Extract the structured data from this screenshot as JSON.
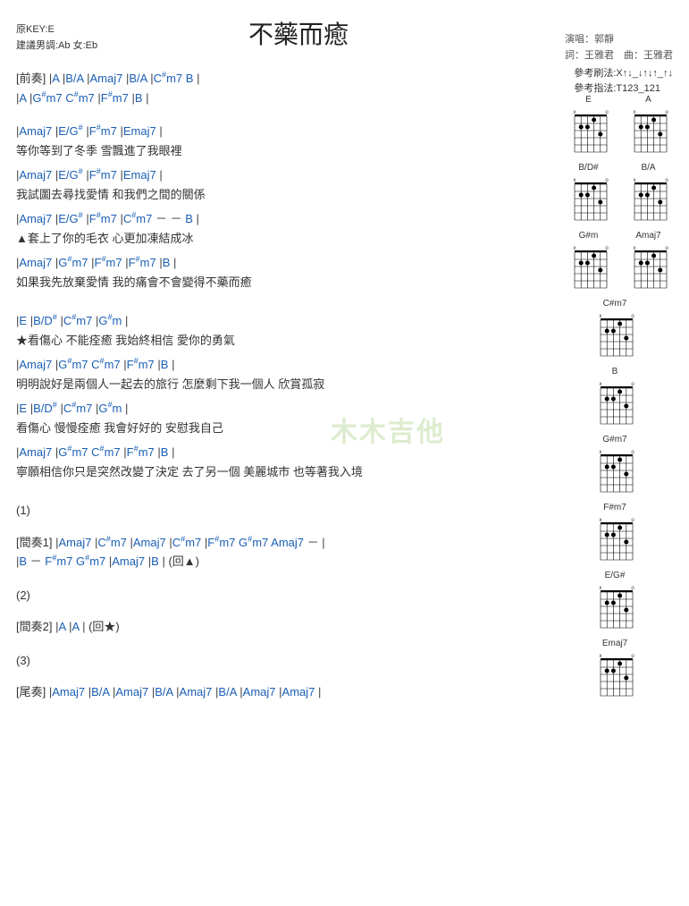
{
  "title": "不藥而癒",
  "meta": {
    "original_key": "原KEY:E",
    "suggested_key": "建議男調:Ab 女:Eb",
    "singer": "演唱：郭靜",
    "credits": "詞：王雅君　曲：王雅君"
  },
  "reference": {
    "strum": "參考刷法:X↑↓_↓↑↓↑_↑↓",
    "fingering": "參考指法:T123_121"
  },
  "watermark": "木木吉他",
  "chord_diagrams": [
    [
      {
        "name": "E"
      },
      {
        "name": "A"
      }
    ],
    [
      {
        "name": "B/D#"
      },
      {
        "name": "B/A"
      }
    ],
    [
      {
        "name": "G#m"
      },
      {
        "name": "Amaj7"
      }
    ],
    [
      {
        "name": "C#m7"
      }
    ],
    [
      {
        "name": "B"
      }
    ],
    [
      {
        "name": "G#m7"
      }
    ],
    [
      {
        "name": "F#m7"
      }
    ],
    [
      {
        "name": "E/G#"
      }
    ],
    [
      {
        "name": "Emaj7"
      }
    ]
  ],
  "lines": [
    {
      "type": "chords",
      "html": "<span class='section-label'>[前奏]</span> <span class='bar'>|</span><span class='chord'>A</span>    <span class='bar'>|</span><span class='chord'>B/A</span>    <span class='bar'>|</span><span class='chord'>Amaj7</span>    <span class='bar'>|</span><span class='chord'>B/A</span>    <span class='bar'>|</span><span class='chord'>C<sup>#</sup>m7</span>    <span class='chord'>B</span>    <span class='bar'>|</span>"
    },
    {
      "type": "chords",
      "html": "            <span class='bar'>|</span><span class='chord'>A</span>    <span class='bar'>|</span><span class='chord'>G<sup>#</sup>m7</span>    <span class='chord'>C<sup>#</sup>m7</span>    <span class='bar'>|</span><span class='chord'>F<sup>#</sup>m7</span>    <span class='bar'>|</span><span class='chord'>B</span>    <span class='bar'>|</span>"
    },
    {
      "type": "gap"
    },
    {
      "type": "chords",
      "html": "<span class='bar'>|</span><span class='chord'>Amaj7</span>            <span class='bar'>|</span><span class='chord'>E/G<sup>#</sup></span>      <span class='bar'>|</span><span class='chord'>F<sup>#</sup>m7</span>       <span class='bar'>|</span><span class='chord'>Emaj7</span>    <span class='bar'>|</span>"
    },
    {
      "type": "lyric",
      "text": "  等你等到了冬季       雪飄進了我眼裡"
    },
    {
      "type": "chords",
      "html": "<span class='bar'>|</span><span class='chord'>Amaj7</span>            <span class='bar'>|</span><span class='chord'>E/G<sup>#</sup></span>      <span class='bar'>|</span><span class='chord'>F<sup>#</sup>m7</span>       <span class='bar'>|</span><span class='chord'>Emaj7</span>    <span class='bar'>|</span>"
    },
    {
      "type": "lyric",
      "text": "  我試圖去尋找愛情   和我們之間的關係"
    },
    {
      "type": "chords",
      "html": "<span class='bar'>|</span><span class='chord'>Amaj7</span>            <span class='bar'>|</span><span class='chord'>E/G<sup>#</sup></span>     <span class='bar'>|</span><span class='chord'>F<sup>#</sup>m7</span>    <span class='bar'>|</span><span class='chord'>C<sup>#</sup>m7</span> － － <span class='chord'>B</span>    <span class='bar'>|</span>"
    },
    {
      "type": "lyric",
      "text": "▲套上了你的毛衣     心更加凍結成冰"
    },
    {
      "type": "chords",
      "html": "<span class='bar'>|</span><span class='chord'>Amaj7</span>        <span class='bar'>|</span><span class='chord'>G<sup>#</sup>m7</span>    <span class='bar'>|</span><span class='chord'>F<sup>#</sup>m7</span>           <span class='bar'>|</span><span class='chord'>F<sup>#</sup>m7</span>               <span class='bar'>|</span><span class='chord'>B</span>    <span class='bar'>|</span>"
    },
    {
      "type": "lyric",
      "text": "  如果我先放棄愛情          我的痛會不會變得不藥而癒"
    },
    {
      "type": "gap"
    },
    {
      "type": "chords",
      "html": "  <span class='bar'>|</span><span class='chord'>E</span>             <span class='bar'>|</span><span class='chord'>B/D<sup>#</sup></span>          <span class='bar'>|</span><span class='chord'>C<sup>#</sup>m7</span>          <span class='bar'>|</span><span class='chord'>G<sup>#</sup>m</span>    <span class='bar'>|</span>"
    },
    {
      "type": "lyric",
      "text": "★看傷心    不能痊癒    我始終相信    愛你的勇氣"
    },
    {
      "type": "chords",
      "html": "           <span class='bar'>|</span><span class='chord'>Amaj7</span>                <span class='bar'>|</span><span class='chord'>G<sup>#</sup>m7</span>    <span class='chord'>C<sup>#</sup>m7</span>  <span class='bar'>|</span><span class='chord'>F<sup>#</sup>m7</span>             <span class='bar'>|</span><span class='chord'>B</span>    <span class='bar'>|</span>"
    },
    {
      "type": "lyric",
      "text": "     明明說好是兩個人一起去的旅行    怎麼剩下我一個人   欣賞孤寂"
    },
    {
      "type": "chords",
      "html": "  <span class='bar'>|</span><span class='chord'>E</span>             <span class='bar'>|</span><span class='chord'>B/D<sup>#</sup></span>          <span class='bar'>|</span><span class='chord'>C<sup>#</sup>m7</span>          <span class='bar'>|</span><span class='chord'>G<sup>#</sup>m</span>    <span class='bar'>|</span>"
    },
    {
      "type": "lyric",
      "text": "  看傷心    慢慢痊癒    我會好好的    安慰我自己"
    },
    {
      "type": "chords",
      "html": "           <span class='bar'>|</span><span class='chord'>Amaj7</span>               <span class='bar'>|</span><span class='chord'>G<sup>#</sup>m7</span>    <span class='chord'>C<sup>#</sup>m7</span>  <span class='bar'>|</span><span class='chord'>F<sup>#</sup>m7</span>               <span class='bar'>|</span><span class='chord'>B</span>          <span class='bar'>|</span>"
    },
    {
      "type": "lyric",
      "text": "     寧願相信你只是突然改變了決定      去了另一個 美麗城市   也等著我入境"
    },
    {
      "type": "gap"
    },
    {
      "type": "lyric",
      "text": "(1)"
    },
    {
      "type": "small-gap"
    },
    {
      "type": "chords",
      "html": "<span class='section-label'>[間奏1]</span> <span class='bar'>|</span><span class='chord'>Amaj7</span>    <span class='bar'>|</span><span class='chord'>C<sup>#</sup>m7</span>    <span class='bar'>|</span><span class='chord'>Amaj7</span>    <span class='bar'>|</span><span class='chord'>C<sup>#</sup>m7</span>    <span class='bar'>|</span><span class='chord'>F<sup>#</sup>m7</span>   <span class='chord'>G<sup>#</sup>m7</span>   <span class='chord'>Amaj7</span> － <span class='bar'>|</span>"
    },
    {
      "type": "chords",
      "html": "              <span class='bar'>|</span><span class='chord'>B</span> － <span class='chord'>F<sup>#</sup>m7</span>  <span class='chord'>G<sup>#</sup>m7</span>    <span class='bar'>|</span><span class='chord'>Amaj7</span>    <span class='bar'>|</span><span class='chord'>B</span>    <span class='bar'>|</span>   <span class='lyric-only'>(回▲)</span>"
    },
    {
      "type": "gap"
    },
    {
      "type": "lyric",
      "text": "(2)"
    },
    {
      "type": "small-gap"
    },
    {
      "type": "chords",
      "html": "<span class='section-label'>[間奏2]</span> <span class='bar'>|</span><span class='chord'>A</span>    <span class='bar'>|</span><span class='chord'>A</span>    <span class='bar'>|</span>   <span class='lyric-only'>(回★)</span>"
    },
    {
      "type": "gap"
    },
    {
      "type": "lyric",
      "text": "(3)"
    },
    {
      "type": "small-gap"
    },
    {
      "type": "chords",
      "html": "<span class='section-label'>[尾奏]</span> <span class='bar'>|</span><span class='chord'>Amaj7</span>    <span class='bar'>|</span><span class='chord'>B/A</span>    <span class='bar'>|</span><span class='chord'>Amaj7</span>    <span class='bar'>|</span><span class='chord'>B/A</span>    <span class='bar'>|</span><span class='chord'>Amaj7</span>    <span class='bar'>|</span><span class='chord'>B/A</span>    <span class='bar'>|</span><span class='chord'>Amaj7</span>    <span class='bar'>|</span><span class='chord'>Amaj7</span>    <span class='bar'>|</span>"
    }
  ]
}
